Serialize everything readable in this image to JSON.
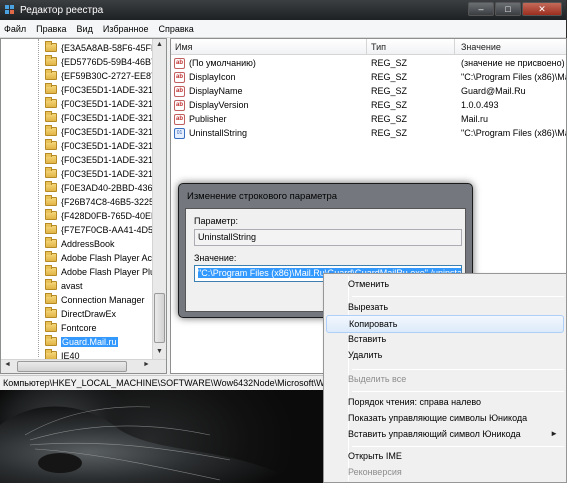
{
  "window": {
    "title": "Редактор реестра",
    "controls": {
      "minimize": "–",
      "maximize": "□",
      "close": "✕"
    }
  },
  "menubar": [
    "Файл",
    "Правка",
    "Вид",
    "Избранное",
    "Справка"
  ],
  "tree": {
    "items": [
      "{E3A5A8AB-58F6-45FF-",
      "{ED5776D5-59B4-46B7-",
      "{EF59B30C-2727-EE87-",
      "{F0C3E5D1-1ADE-321E",
      "{F0C3E5D1-1ADE-321E",
      "{F0C3E5D1-1ADE-321E",
      "{F0C3E5D1-1ADE-321E",
      "{F0C3E5D1-1ADE-321E",
      "{F0C3E5D1-1ADE-321E",
      "{F0C3E5D1-1ADE-321E",
      "{F0E3AD40-2BBD-4360-",
      "{F26B74C8-46B5-3225-",
      "{F428D0FB-765D-40EB-",
      "{F7E7F0CB-AA41-4D5A",
      "AddressBook",
      "Adobe Flash Player Act",
      "Adobe Flash Player Plu",
      "avast",
      "Connection Manager",
      "DirectDrawEx",
      "Fontcore",
      "Guard.Mail.ru",
      "IE40"
    ],
    "selected_index": 21,
    "scroll_up": "▲",
    "scroll_down": "▼",
    "scroll_left": "◄",
    "scroll_right": "►"
  },
  "list": {
    "columns": {
      "name": "Имя",
      "type": "Тип",
      "value": "Значение"
    },
    "rows": [
      {
        "icon": "string-value-icon",
        "name": "(По умолчанию)",
        "type": "REG_SZ",
        "value": "(значение не присвоено)"
      },
      {
        "icon": "string-value-icon",
        "name": "DisplayIcon",
        "type": "REG_SZ",
        "value": "\"C:\\Program Files (x86)\\Mail"
      },
      {
        "icon": "string-value-icon",
        "name": "DisplayName",
        "type": "REG_SZ",
        "value": "Guard@Mail.Ru"
      },
      {
        "icon": "string-value-icon",
        "name": "DisplayVersion",
        "type": "REG_SZ",
        "value": "1.0.0.493"
      },
      {
        "icon": "string-value-icon",
        "name": "Publisher",
        "type": "REG_SZ",
        "value": "Mail.ru"
      },
      {
        "icon": "binary-value-icon",
        "name": "UninstallString",
        "type": "REG_SZ",
        "value": "\"C:\\Program Files (x86)\\Mail"
      }
    ]
  },
  "statusbar": "Компьютер\\HKEY_LOCAL_MACHINE\\SOFTWARE\\Wow6432Node\\Microsoft\\W",
  "dialog": {
    "title": "Изменение строкового параметра",
    "param_label": "Параметр:",
    "param_value": "UninstallString",
    "value_label": "Значение:",
    "value": "\"C:\\Program Files (x86)\\Mail.Ru\\Guard\\GuardMailRu.exe\" /uninstall"
  },
  "context_menu": {
    "items": [
      {
        "label": "Отменить",
        "state": "normal"
      },
      {
        "label": "Вырезать",
        "state": "normal"
      },
      {
        "label": "Копировать",
        "state": "hover"
      },
      {
        "label": "Вставить",
        "state": "normal"
      },
      {
        "label": "Удалить",
        "state": "normal"
      },
      {
        "label": "Выделить все",
        "state": "disabled"
      },
      {
        "label": "Порядок чтения: справа налево",
        "state": "normal"
      },
      {
        "label": "Показать управляющие символы Юникода",
        "state": "normal"
      },
      {
        "label": "Вставить управляющий символ Юникода",
        "state": "normal",
        "submenu": "►"
      },
      {
        "label": "Открыть IME",
        "state": "normal"
      },
      {
        "label": "Реконверсия",
        "state": "disabled"
      }
    ]
  }
}
